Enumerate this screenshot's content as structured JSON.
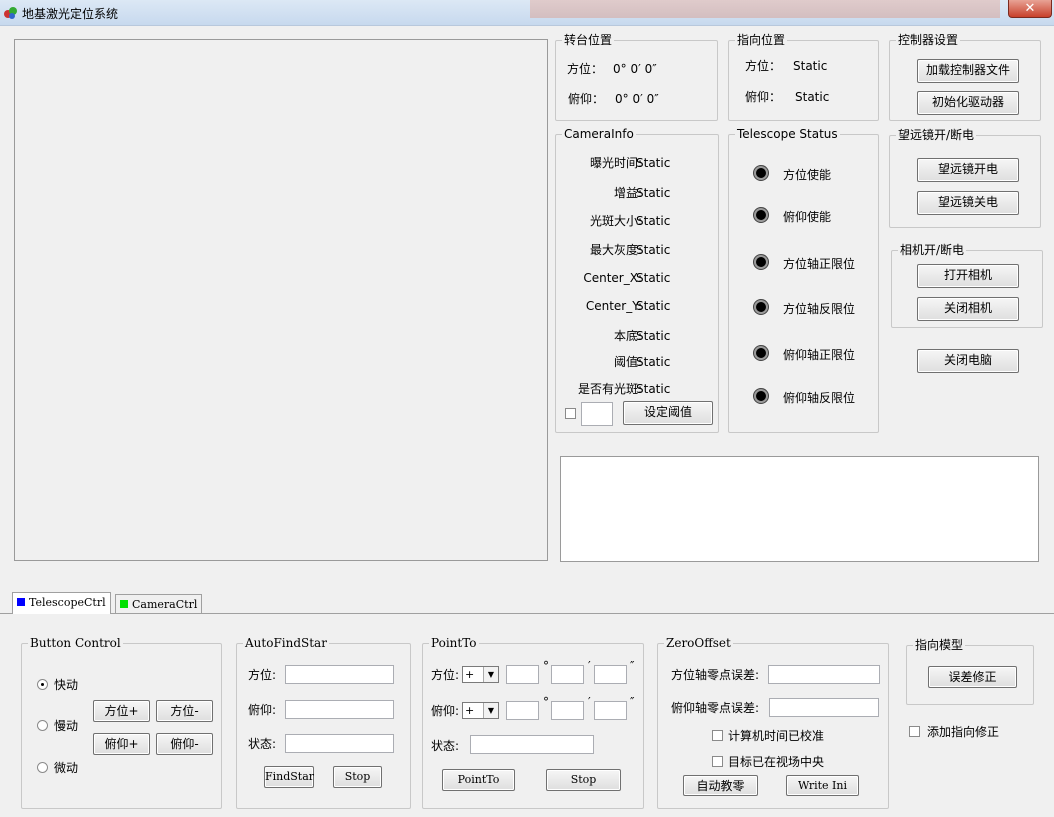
{
  "window": {
    "title": "地基激光定位系统",
    "close": "✕"
  },
  "turret": {
    "legend": "转台位置",
    "az_label": "方位：",
    "az_value": "0° 0′ 0″",
    "el_label": "俯仰：",
    "el_value": "0° 0′ 0″"
  },
  "pointing": {
    "legend": "指向位置",
    "az_label": "方位：",
    "az_value": "Static",
    "el_label": "俯仰：",
    "el_value": "Static"
  },
  "controller": {
    "legend": "控制器设置",
    "load": "加载控制器文件",
    "init": "初始化驱动器"
  },
  "camera_info": {
    "legend": "CameraInfo",
    "rows": [
      {
        "label": "曝光时间:",
        "value": "Static"
      },
      {
        "label": "增益:",
        "value": "Static"
      },
      {
        "label": "光斑大小:",
        "value": "Static"
      },
      {
        "label": "最大灰度:",
        "value": "Static"
      },
      {
        "label": "Center_X:",
        "value": "Static"
      },
      {
        "label": "Center_Y:",
        "value": "Static"
      },
      {
        "label": "本底:",
        "value": "Static"
      },
      {
        "label": "阈值:",
        "value": "Static"
      },
      {
        "label": "是否有光斑:",
        "value": "Static"
      }
    ],
    "set_threshold": "设定阈值"
  },
  "tele_status": {
    "legend": "Telescope Status",
    "items": [
      "方位使能",
      "俯仰使能",
      "方位轴正限位",
      "方位轴反限位",
      "俯仰轴正限位",
      "俯仰轴反限位"
    ]
  },
  "tele_power": {
    "legend": "望远镜开/断电",
    "on": "望远镜开电",
    "off": "望远镜关电"
  },
  "cam_power": {
    "legend": "相机开/断电",
    "on": "打开相机",
    "off": "关闭相机"
  },
  "shutdown": "关闭电脑",
  "tabs": [
    {
      "label": "TelescopeCtrl",
      "color": "#0000ff"
    },
    {
      "label": "CameraCtrl",
      "color": "#00e000"
    }
  ],
  "button_control": {
    "legend": "Button Control",
    "modes": [
      "快动",
      "慢动",
      "微动"
    ],
    "az_plus": "方位+",
    "az_minus": "方位-",
    "el_plus": "俯仰+",
    "el_minus": "俯仰-"
  },
  "autofind": {
    "legend": "AutoFindStar",
    "az": "方位:",
    "el": "俯仰:",
    "state": "状态:",
    "find": "FindStar",
    "stop": "Stop"
  },
  "pointto": {
    "legend": "PointTo",
    "az": "方位:",
    "el": "俯仰:",
    "state": "状态:",
    "sign": "+",
    "deg": "°",
    "min": "′",
    "sec": "″",
    "point": "PointTo",
    "stop": "Stop"
  },
  "zero": {
    "legend": "ZeroOffset",
    "az": "方位轴零点误差:",
    "el": "俯仰轴零点误差:",
    "chk1": "计算机时间已校准",
    "chk2": "目标已在视场中央",
    "auto": "自动教零",
    "write": "Write Ini"
  },
  "model": {
    "legend": "指向模型",
    "correct": "误差修正",
    "add": "添加指向修正"
  }
}
